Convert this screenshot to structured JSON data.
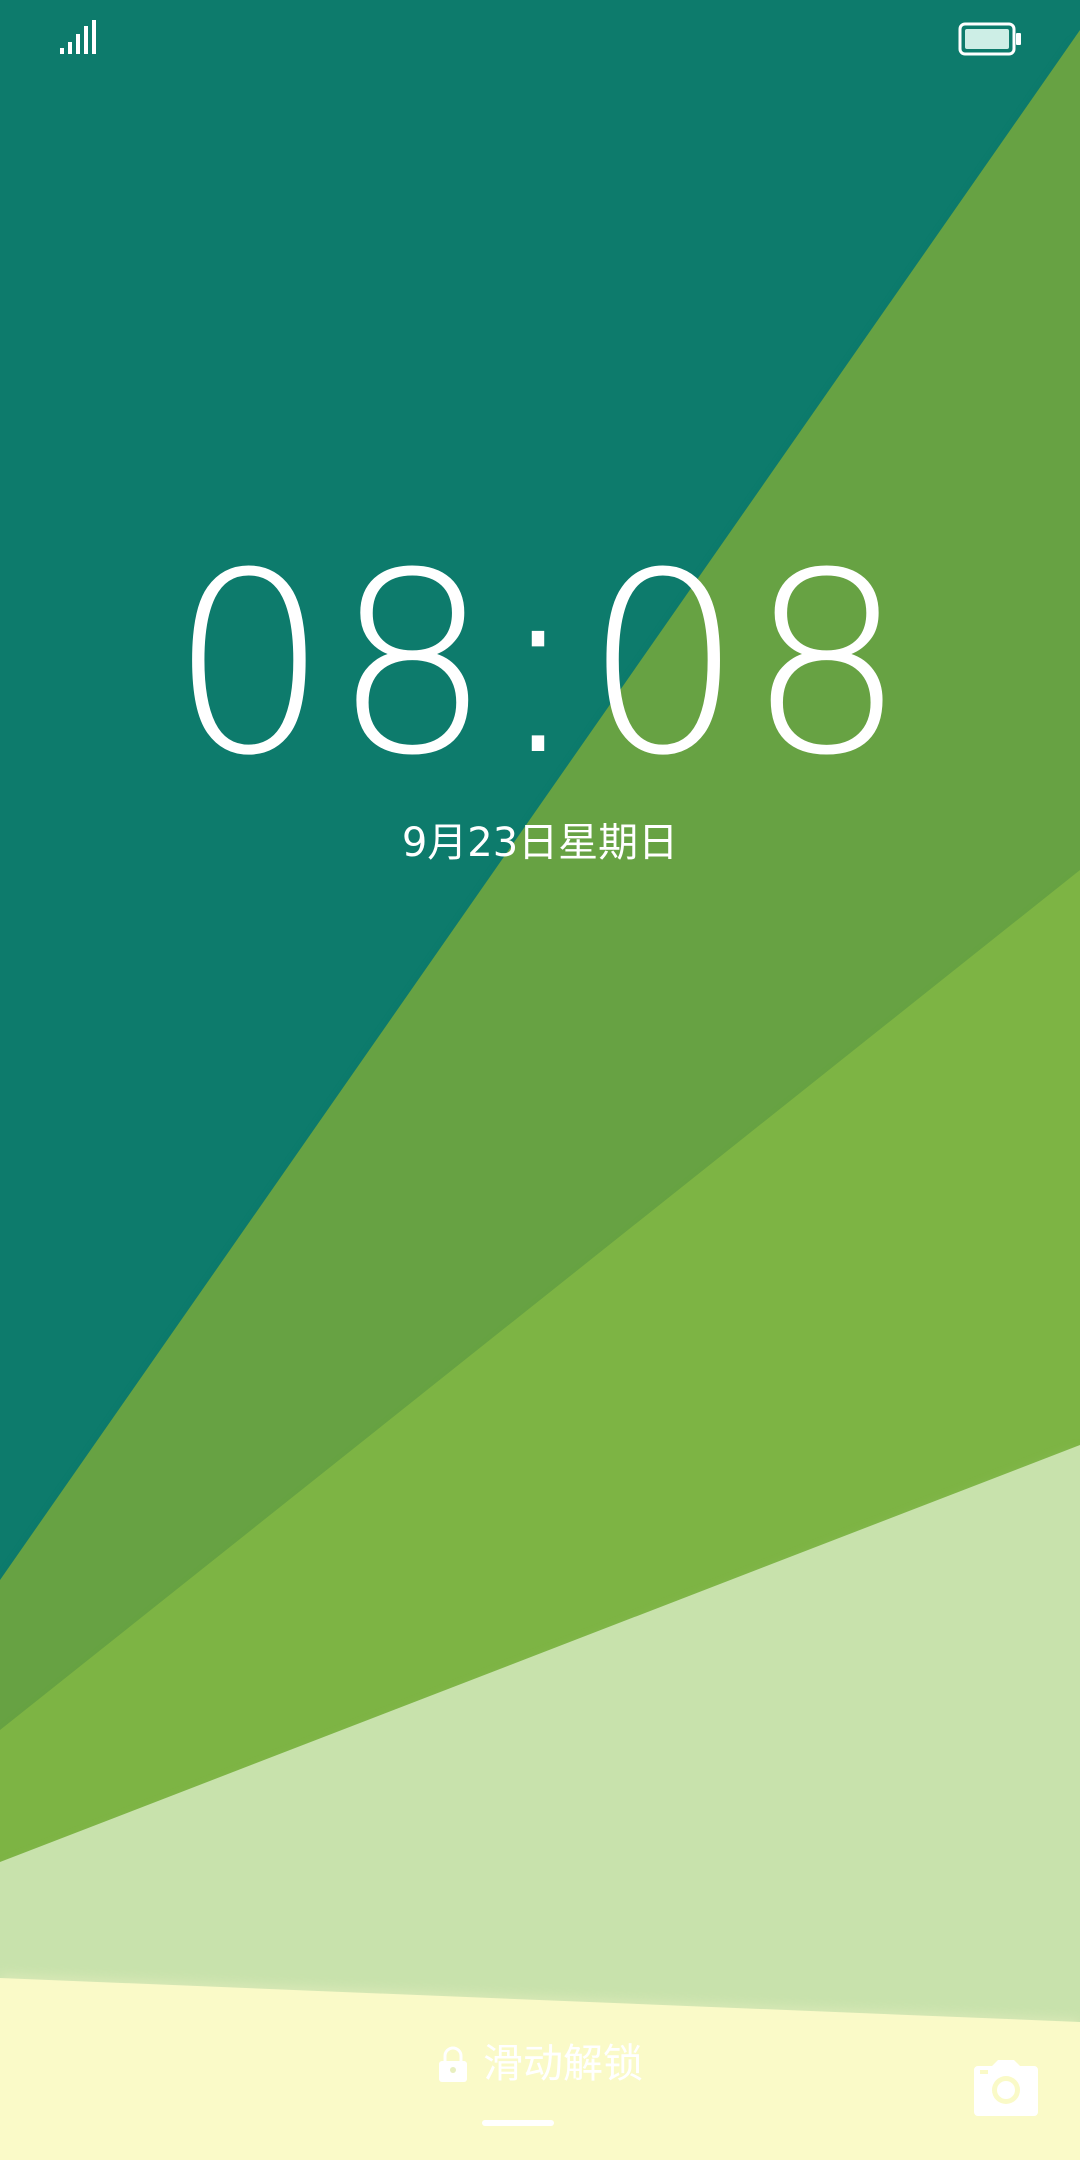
{
  "wallpaper": {
    "colors": {
      "teal": "#0d7b6c",
      "olive_green": "#67a243",
      "grass_green": "#7db444",
      "pale_green": "#c8e2ac",
      "cream": "#fafac8"
    }
  },
  "status_bar": {
    "signal_icon": "signal-bars-icon",
    "battery_icon": "battery-full-icon"
  },
  "lockscreen": {
    "time": "08:08",
    "date": "9月23日星期日",
    "unlock_label": "滑动解锁",
    "lock_icon": "lock-icon",
    "camera_icon": "camera-icon"
  }
}
